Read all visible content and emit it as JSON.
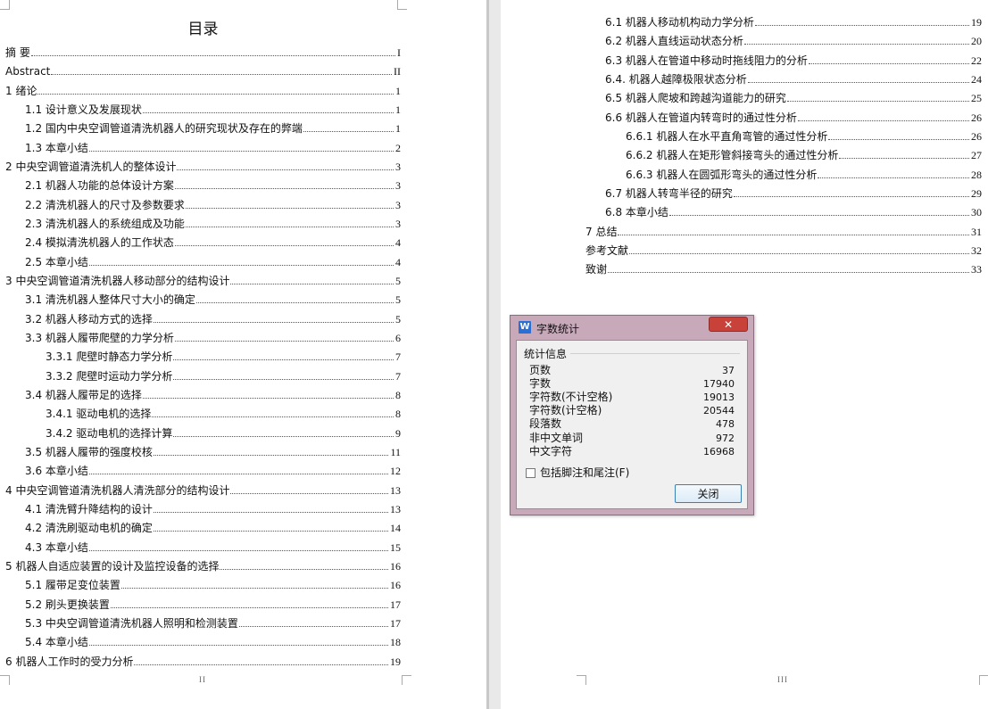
{
  "toc_title": "目录",
  "toc_left": [
    {
      "text": "摘  要",
      "page": "I"
    },
    {
      "text": "Abstract",
      "page": "II"
    },
    {
      "text": "1 绪论",
      "page": "1"
    },
    {
      "text": "1.1 设计意义及发展现状",
      "page": "1"
    },
    {
      "text": "1.2 国内中央空调管道清洗机器人的研究现状及存在的弊端",
      "page": "1"
    },
    {
      "text": "1.3 本章小结",
      "page": "2"
    },
    {
      "text": "2 中央空调管道清洗机人的整体设计",
      "page": "3"
    },
    {
      "text": "2.1 机器人功能的总体设计方案",
      "page": "3"
    },
    {
      "text": "2.2 清洗机器人的尺寸及参数要求",
      "page": "3"
    },
    {
      "text": "2.3 清洗机器人的系统组成及功能",
      "page": "3"
    },
    {
      "text": "2.4 模拟清洗机器人的工作状态",
      "page": "4"
    },
    {
      "text": "2.5 本章小结",
      "page": "4"
    },
    {
      "text": "3 中央空调管道清洗机器人移动部分的结构设计",
      "page": "5"
    },
    {
      "text": "3.1 清洗机器人整体尺寸大小的确定",
      "page": "5"
    },
    {
      "text": "3.2 机器人移动方式的选择",
      "page": "5"
    },
    {
      "text": "3.3 机器人履带爬壁的力学分析",
      "page": "6"
    },
    {
      "text": "3.3.1 爬壁时静态力学分析",
      "page": "7"
    },
    {
      "text": "3.3.2 爬壁时运动力学分析",
      "page": "7"
    },
    {
      "text": "3.4 机器人履带足的选择",
      "page": "8"
    },
    {
      "text": "3.4.1 驱动电机的选择",
      "page": "8"
    },
    {
      "text": "3.4.2 驱动电机的选择计算",
      "page": "9"
    },
    {
      "text": "3.5 机器人履带的强度校核",
      "page": "11"
    },
    {
      "text": "3.6 本章小结",
      "page": "12"
    },
    {
      "text": "4 中央空调管道清洗机器人清洗部分的结构设计",
      "page": "13"
    },
    {
      "text": "4.1  清洗臂升降结构的设计",
      "page": "13"
    },
    {
      "text": "4.2  清洗刷驱动电机的确定",
      "page": "14"
    },
    {
      "text": "4.3  本章小结",
      "page": "15"
    },
    {
      "text": "5 机器人自适应装置的设计及监控设备的选择",
      "page": "16"
    },
    {
      "text": "5.1 履带足变位装置",
      "page": "16"
    },
    {
      "text": "5.2 刷头更换装置",
      "page": "17"
    },
    {
      "text": "5.3 中央空调管道清洗机器人照明和检测装置",
      "page": "17"
    },
    {
      "text": "5.4 本章小结",
      "page": "18"
    },
    {
      "text": "6 机器人工作时的受力分析",
      "page": "19"
    }
  ],
  "toc_right": [
    {
      "text": "6.1 机器人移动机构动力学分析",
      "page": "19"
    },
    {
      "text": "6.2 机器人直线运动状态分析",
      "page": "20"
    },
    {
      "text": "6.3 机器人在管道中移动时拖线阻力的分析",
      "page": "22"
    },
    {
      "text": "6.4. 机器人越障极限状态分析",
      "page": "24"
    },
    {
      "text": "6.5 机器人爬坡和跨越沟道能力的研究",
      "page": "25"
    },
    {
      "text": "6.6 机器人在管道内转弯时的通过性分析",
      "page": "26"
    },
    {
      "text": "6.6.1 机器人在水平直角弯管的通过性分析",
      "page": "26"
    },
    {
      "text": "6.6.2 机器人在矩形管斜接弯头的通过性分析",
      "page": "27"
    },
    {
      "text": "6.6.3 机器人在圆弧形弯头的通过性分析",
      "page": "28"
    },
    {
      "text": "6.7 机器人转弯半径的研究",
      "page": "29"
    },
    {
      "text": "6.8 本章小结",
      "page": "30"
    },
    {
      "text": "7 总结",
      "page": "31"
    },
    {
      "text": "参考文献",
      "page": "32"
    },
    {
      "text": "致谢",
      "page": "33"
    }
  ],
  "footer": {
    "left_page_num": "II",
    "right_page_num": "III"
  },
  "dialog": {
    "app_icon": "W",
    "title": "字数统计",
    "close_symbol": "✕",
    "group_label": "统计信息",
    "stats": [
      {
        "label": "页数",
        "value": "37"
      },
      {
        "label": "字数",
        "value": "17940"
      },
      {
        "label": "字符数(不计空格)",
        "value": "19013"
      },
      {
        "label": "字符数(计空格)",
        "value": "20544"
      },
      {
        "label": "段落数",
        "value": "478"
      },
      {
        "label": "非中文单词",
        "value": "972"
      },
      {
        "label": "中文字符",
        "value": "16968"
      }
    ],
    "checkbox_label": "包括脚注和尾注(F)",
    "checkbox_checked": false,
    "close_button": "关闭",
    "accent_color": "#c7a9ba",
    "close_color": "#c9423a"
  }
}
